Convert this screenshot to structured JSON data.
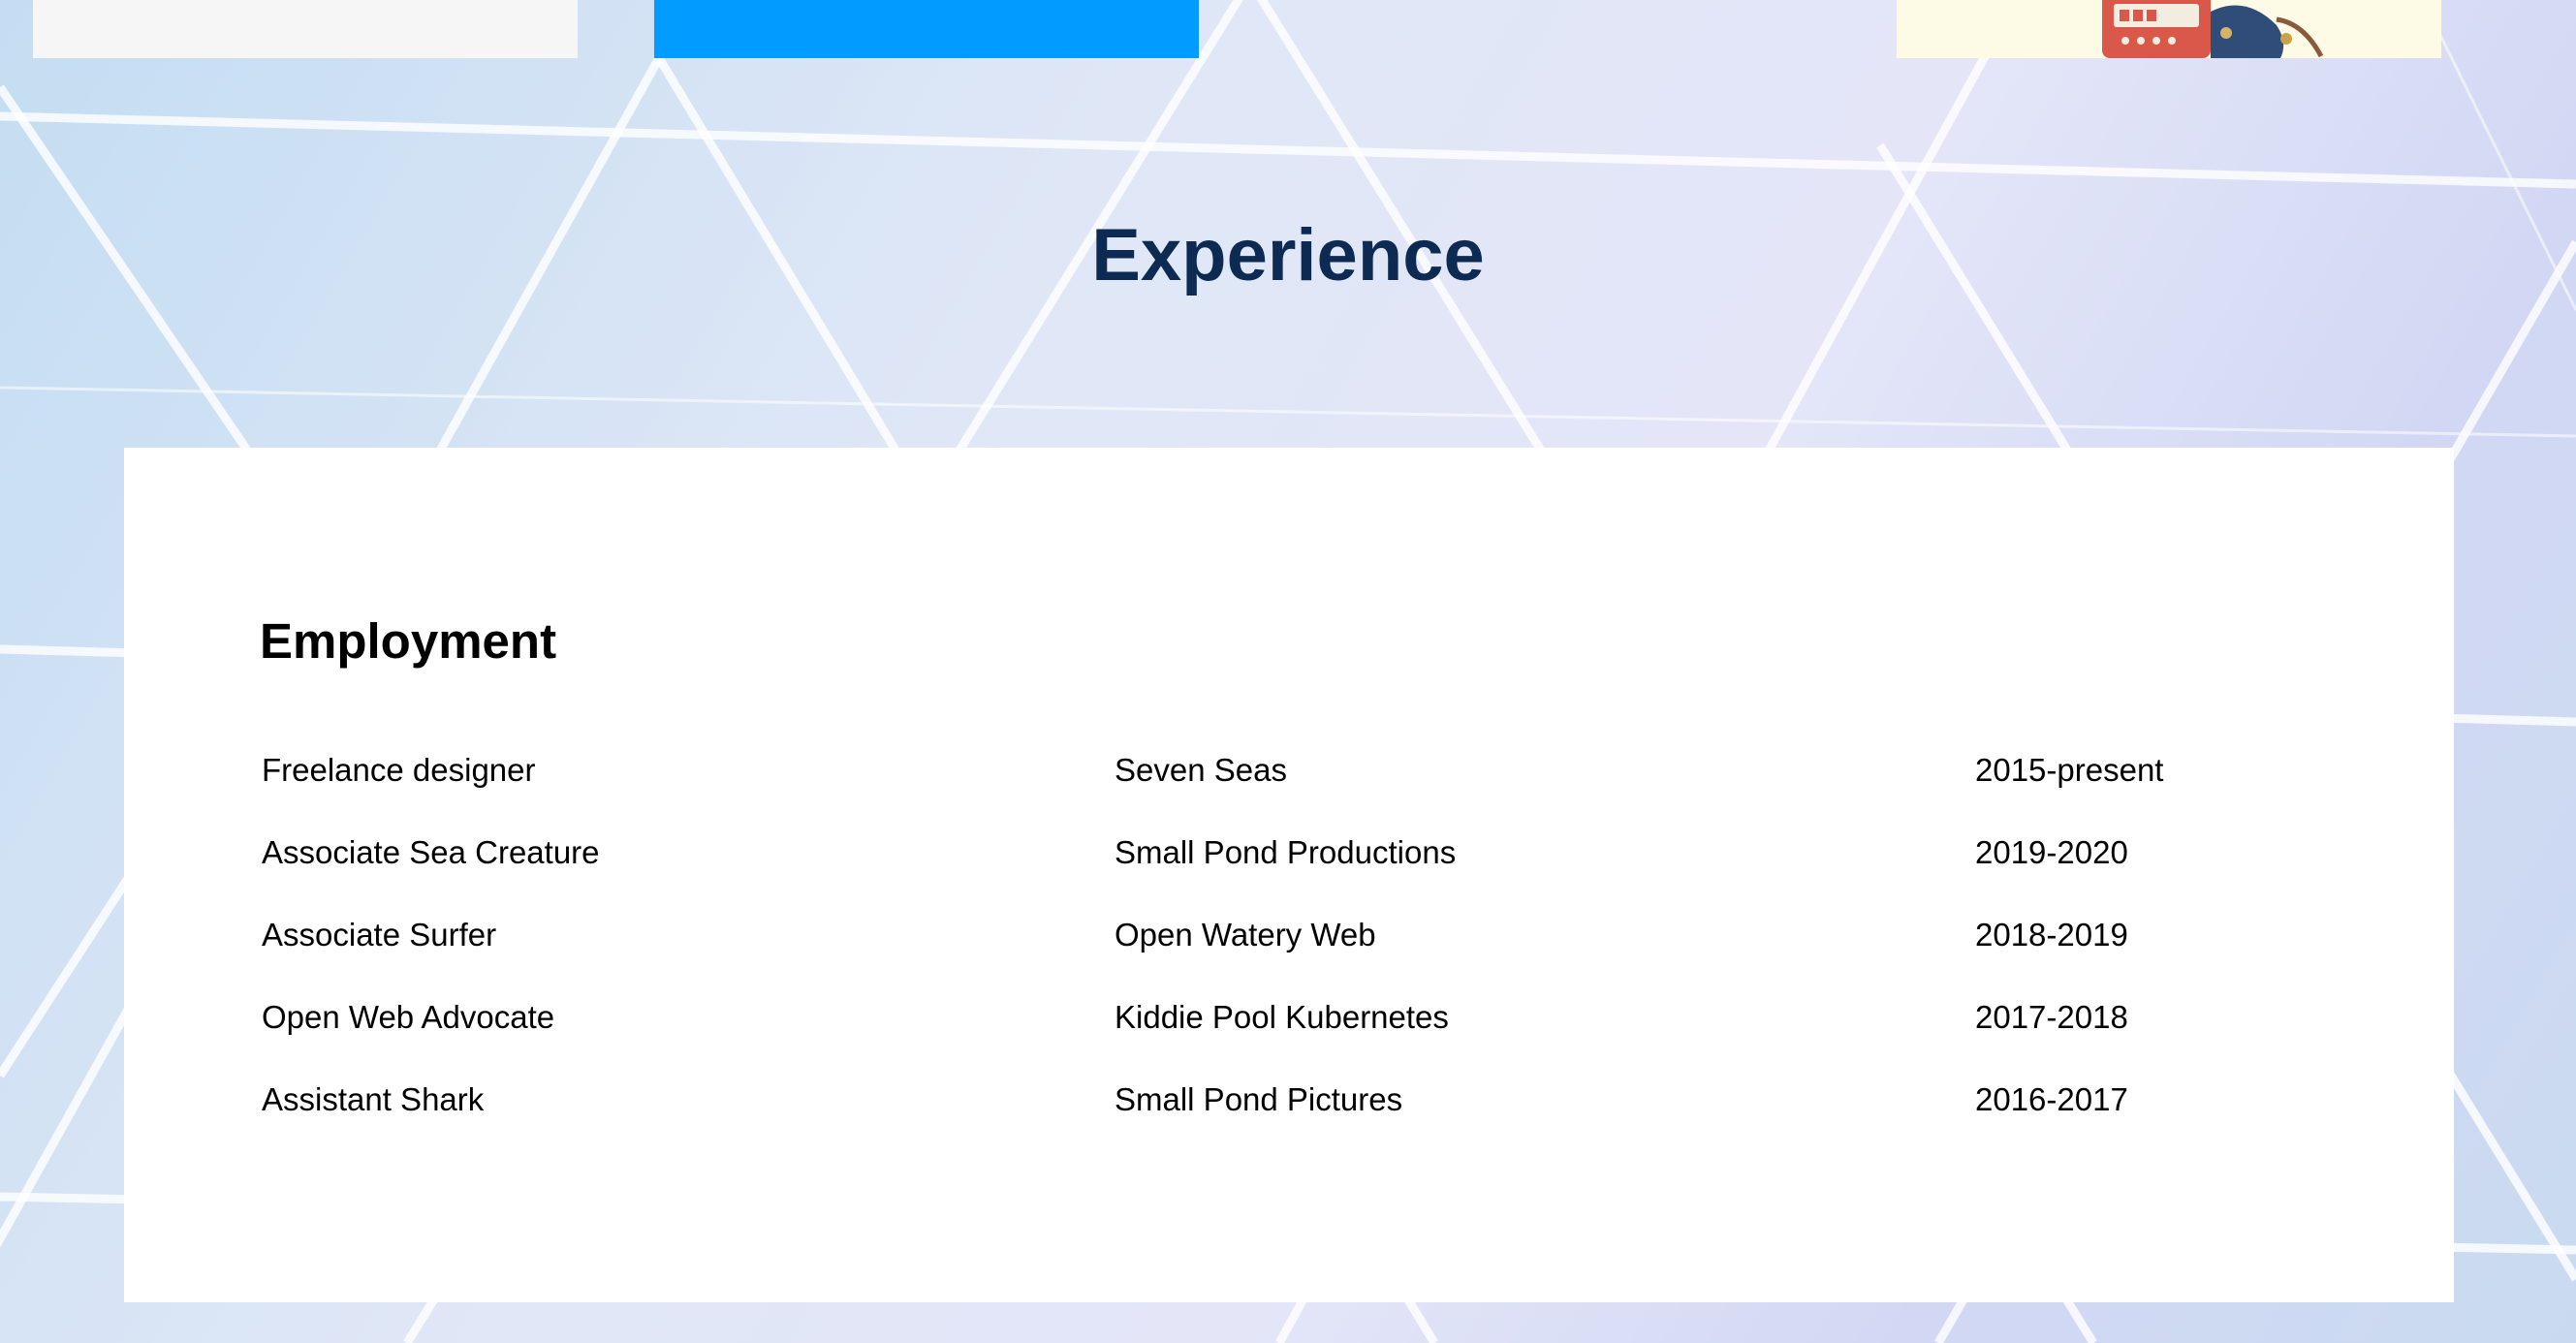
{
  "section": {
    "title": "Experience"
  },
  "employment": {
    "heading": "Employment",
    "jobs": [
      {
        "role": "Freelance designer",
        "company": "Seven Seas",
        "dates": "2015-present"
      },
      {
        "role": "Associate Sea Creature",
        "company": "Small Pond Productions",
        "dates": "2019-2020"
      },
      {
        "role": "Associate Surfer",
        "company": "Open Watery Web",
        "dates": "2018-2019"
      },
      {
        "role": "Open Web Advocate",
        "company": "Kiddie Pool Kubernetes",
        "dates": "2017-2018"
      },
      {
        "role": "Assistant Shark",
        "company": "Small Pond Pictures",
        "dates": "2016-2017"
      }
    ]
  },
  "colors": {
    "title": "#0c2a52",
    "accent_card": "#009cff",
    "panel": "#ffffff"
  }
}
